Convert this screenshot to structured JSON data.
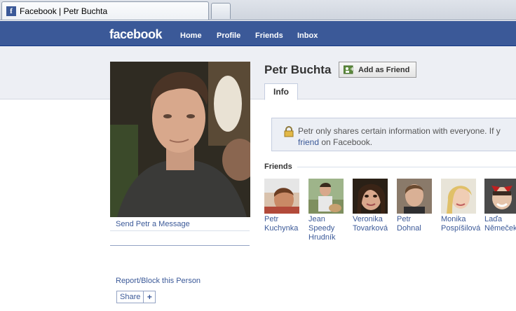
{
  "browser": {
    "tab_title": "Facebook | Petr Buchta",
    "tab_favicon_letter": "f"
  },
  "fb": {
    "logo": "facebook",
    "nav": [
      "Home",
      "Profile",
      "Friends",
      "Inbox"
    ]
  },
  "profile": {
    "name": "Petr Buchta",
    "add_friend_label": "Add as Friend",
    "tab_info": "Info",
    "send_message": "Send Petr a Message",
    "report": "Report/Block this Person",
    "share": "Share",
    "share_plus": "+"
  },
  "notice": {
    "line1": "Petr only shares certain information with everyone. If y",
    "line2_link": "friend",
    "line2_rest": " on Facebook."
  },
  "friends": {
    "heading": "Friends",
    "items": [
      {
        "name": "Petr Kuchynka"
      },
      {
        "name": "Jean Speedy Hrudník"
      },
      {
        "name": "Veronika Tovarková"
      },
      {
        "name": "Petr Dohnal"
      },
      {
        "name": "Monika Pospíšilová"
      },
      {
        "name": "Laďa Němeček"
      }
    ]
  },
  "colors": {
    "fb_blue": "#3b5998",
    "band_grey": "#edeff4"
  }
}
